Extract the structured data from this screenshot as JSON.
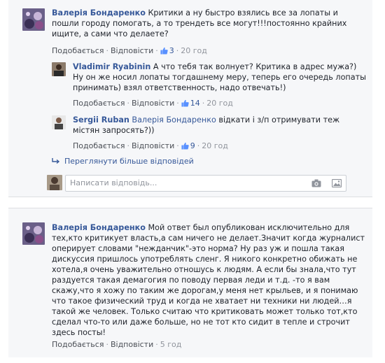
{
  "actions": {
    "like": "Подобається",
    "reply": "Відповісти",
    "sep": "·"
  },
  "thread1": {
    "author": "Валерія Бондаренко",
    "text": "Критики а ну быстро взялись все за лопаты и пошли городу помогать, а то трендеть все могут!!!постоянно крайних ищите, а сами что делаете?",
    "likes": "3",
    "time": "20 год",
    "replies": [
      {
        "author": "Vladimir Ryabinin",
        "text": "А что тебя так волнует? Критика в адрес мужа?) Ну он же носил лопаты тогдашнему меру, теперь его очередь лопаты принимать) взял ответственность, надо отвечать!)",
        "likes": "14",
        "time": "20 год"
      },
      {
        "author": "Sergii Ruban",
        "mention": "Валерія Бондаренко",
        "text": "відкати і з/п отримувати теж містян запросять?))",
        "likes": "9",
        "time": "20 год"
      }
    ],
    "more_replies": "Переглянути більше відповідей",
    "input_placeholder": "Написати відповідь..."
  },
  "thread2": {
    "author": "Валерія Бондаренко",
    "text": "Мой ответ был опубликован исключительно для тех,кто критикует власть,а сам ничего не делает.Значит когда журналист оперирует словами \"нежданчик\"-это норма? Ну раз уж и пошла такая дискуссия пришлось употреблять сленг. Я никого конкретно обижать не хотела,я очень уважительно отношусь к людям. А если бы знала,что тут раздуется такая демагогия по поводу первая леди и т.д. -то я вам скажу,что я хожу по таким же дорогам,у меня нет крыльев, и я понимаю что такое физический труд и когда не хватает ни техники ни людей…я такой же человек. Только считаю что критиковать может только тот,кто сделал что-то или даже больше, но не тот кто сидит в тепле и строчит здесь посты!",
    "time": "5 год"
  },
  "colors": {
    "link": "#365899",
    "meta": "#90949c",
    "panel": "#f6f7f9",
    "border": "#dddfe2"
  }
}
